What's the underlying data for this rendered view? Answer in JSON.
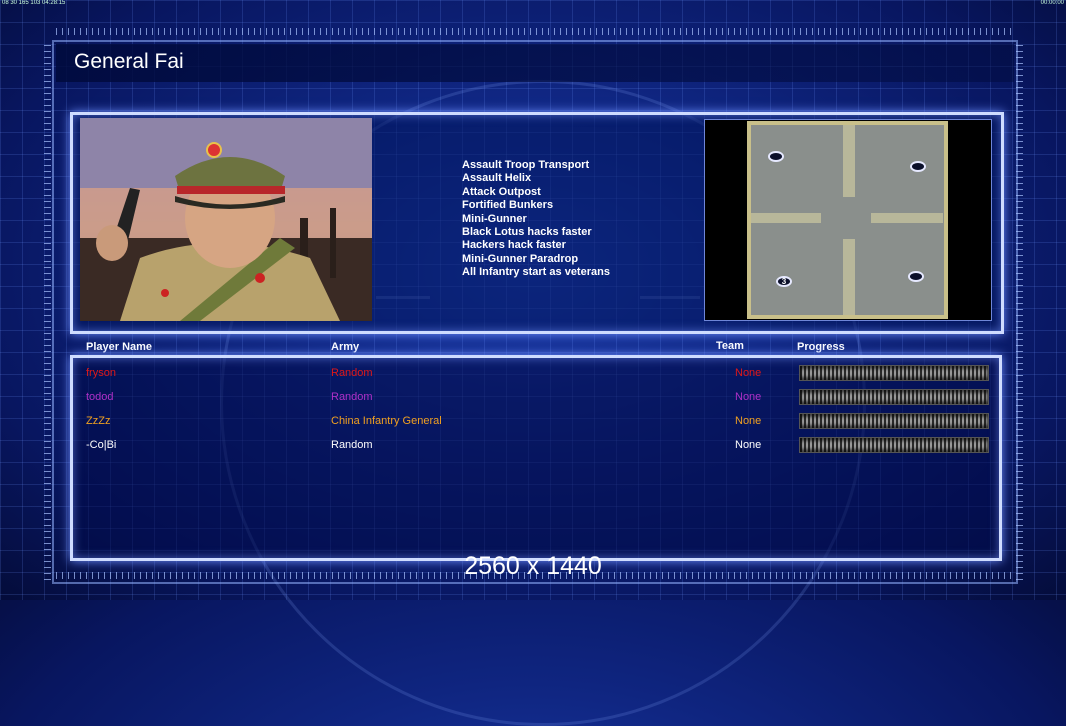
{
  "topbar": {
    "left": "08 30 165 103 04:28:15",
    "right": "00:00:00"
  },
  "title": "General Fai",
  "bonuses": [
    "Assault Troop Transport",
    "Assault Helix",
    "Attack Outpost",
    "Fortified Bunkers",
    "Mini-Gunner",
    "Black Lotus hacks faster",
    "Hackers hack faster",
    "Mini-Gunner Paradrop",
    "All Infantry start as veterans"
  ],
  "map": {
    "spot_label": "3"
  },
  "columns": {
    "player": "Player Name",
    "army": "Army",
    "team": "Team",
    "progress": "Progress"
  },
  "players": [
    {
      "name": "fryson",
      "army": "Random",
      "team": "None",
      "color": "#e01818"
    },
    {
      "name": "todod",
      "army": "Random",
      "team": "None",
      "color": "#b030c8"
    },
    {
      "name": "ZzZz",
      "army": "China Infantry General",
      "team": "None",
      "color": "#f0a020"
    },
    {
      "name": "-Co|Bi",
      "army": "Random",
      "team": "None",
      "color": "#ffffff"
    }
  ],
  "resolution": "2560 x 1440"
}
